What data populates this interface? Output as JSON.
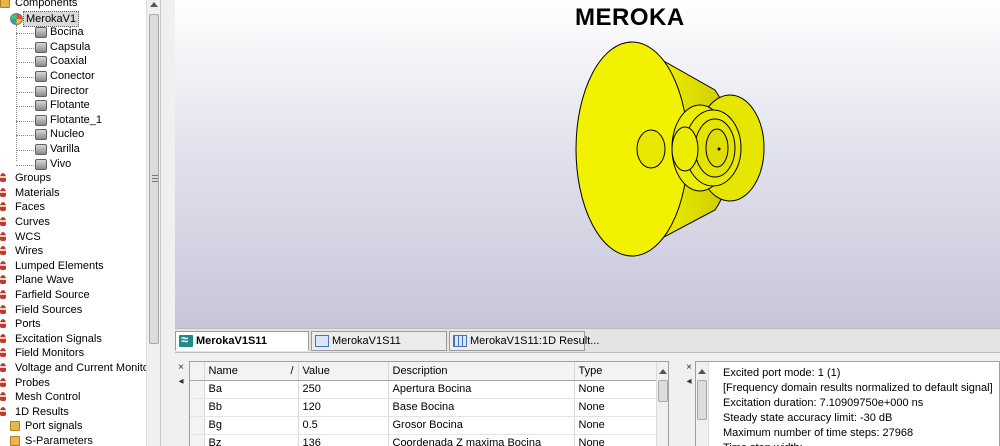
{
  "tree": {
    "items": [
      {
        "label": "Components",
        "icon": "folder-icon",
        "level": 0
      },
      {
        "label": "MerokaV1",
        "icon": "component-group-icon",
        "level": 1,
        "selected": true
      },
      {
        "label": "Bocina",
        "icon": "solid-icon",
        "level": 2
      },
      {
        "label": "Capsula",
        "icon": "solid-icon",
        "level": 2
      },
      {
        "label": "Coaxial",
        "icon": "solid-icon",
        "level": 2
      },
      {
        "label": "Conector",
        "icon": "solid-icon",
        "level": 2
      },
      {
        "label": "Director",
        "icon": "solid-icon",
        "level": 2
      },
      {
        "label": "Flotante",
        "icon": "solid-icon",
        "level": 2
      },
      {
        "label": "Flotante_1",
        "icon": "solid-icon",
        "level": 2
      },
      {
        "label": "Nucleo",
        "icon": "solid-icon",
        "level": 2
      },
      {
        "label": "Varilla",
        "icon": "solid-icon",
        "level": 2
      },
      {
        "label": "Vivo",
        "icon": "solid-icon",
        "level": 2
      },
      {
        "label": "Groups",
        "icon": "tree-node-icon",
        "level": 0
      },
      {
        "label": "Materials",
        "icon": "tree-node-icon",
        "level": 0
      },
      {
        "label": "Faces",
        "icon": "tree-node-icon",
        "level": 0
      },
      {
        "label": "Curves",
        "icon": "tree-node-icon",
        "level": 0
      },
      {
        "label": "WCS",
        "icon": "tree-node-icon",
        "level": 0
      },
      {
        "label": "Wires",
        "icon": "tree-node-icon",
        "level": 0
      },
      {
        "label": "Lumped Elements",
        "icon": "tree-node-icon",
        "level": 0
      },
      {
        "label": "Plane Wave",
        "icon": "tree-node-icon",
        "level": 0
      },
      {
        "label": "Farfield Source",
        "icon": "tree-node-icon",
        "level": 0
      },
      {
        "label": "Field Sources",
        "icon": "tree-node-icon",
        "level": 0
      },
      {
        "label": "Ports",
        "icon": "tree-node-icon",
        "level": 0
      },
      {
        "label": "Excitation Signals",
        "icon": "tree-node-icon",
        "level": 0
      },
      {
        "label": "Field Monitors",
        "icon": "tree-node-icon",
        "level": 0
      },
      {
        "label": "Voltage and Current Monitors",
        "icon": "tree-node-icon",
        "level": 0
      },
      {
        "label": "Probes",
        "icon": "tree-node-icon",
        "level": 0
      },
      {
        "label": "Mesh Control",
        "icon": "tree-node-icon",
        "level": 0
      },
      {
        "label": "1D Results",
        "icon": "tree-node-icon",
        "level": 0
      },
      {
        "label": "Port signals",
        "icon": "folder-icon",
        "level": 1
      },
      {
        "label": "S-Parameters",
        "icon": "folder-icon",
        "level": 1
      }
    ]
  },
  "viewport": {
    "title": "MEROKA",
    "model_color": "#f0f000"
  },
  "tabs": [
    {
      "label": "MerokaV1S11",
      "icon": "signal-wave-icon",
      "active": true
    },
    {
      "label": "MerokaV1S11",
      "icon": "window-icon",
      "active": false
    },
    {
      "label": "MerokaV1S11:1D Result...",
      "icon": "grid-table-icon",
      "active": false
    }
  ],
  "parameters": {
    "columns": [
      "Name",
      "Value",
      "Description",
      "Type"
    ],
    "sort_indicator": "/",
    "rows": [
      {
        "name": "Ba",
        "value": "250",
        "description": "Apertura Bocina",
        "type": "None"
      },
      {
        "name": "Bb",
        "value": "120",
        "description": "Base Bocina",
        "type": "None"
      },
      {
        "name": "Bg",
        "value": "0.5",
        "description": "Grosor Bocina",
        "type": "None"
      },
      {
        "name": "Bz",
        "value": "136",
        "description": "Coordenada Z maxima Bocina",
        "type": "None"
      }
    ]
  },
  "messages": {
    "lines": [
      "Excited port mode: 1 (1)",
      "[Frequency domain results normalized to default signal]",
      "Excitation duration: 7.10909750e+000 ns",
      "Steady state accuracy limit: -30 dB",
      "Maximum number of time steps: 27968",
      "Time step width:"
    ]
  },
  "panel_controls": {
    "close": "×",
    "pin": "◂"
  }
}
